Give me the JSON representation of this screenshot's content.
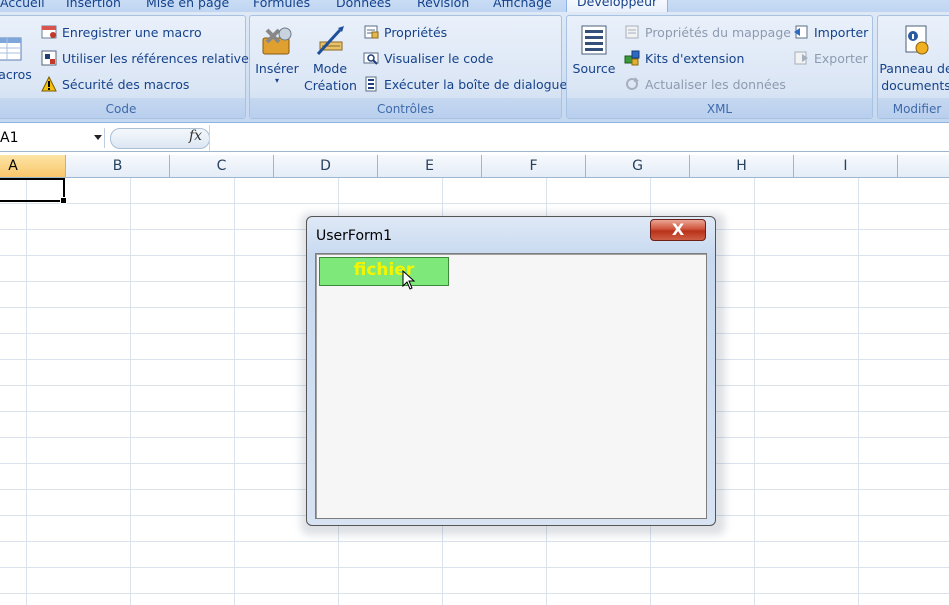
{
  "ribbon": {
    "tabs": [
      "Accueil",
      "Insertion",
      "Mise en page",
      "Formules",
      "Données",
      "Révision",
      "Affichage",
      "Développeur"
    ],
    "active_tab": "Développeur",
    "code": {
      "label": "Code",
      "macros_label": "acros",
      "record_macro": "Enregistrer une macro",
      "relative_refs": "Utiliser les références relatives",
      "macro_security": "Sécurité des macros"
    },
    "controls": {
      "label": "Contrôles",
      "insert": "Insérer",
      "design_mode_line1": "Mode",
      "design_mode_line2": "Création",
      "properties": "Propriétés",
      "view_code": "Visualiser le code",
      "run_dialog": "Exécuter la boîte de dialogue"
    },
    "xml": {
      "label": "XML",
      "source": "Source",
      "map_properties": "Propriétés du mappage",
      "expansion_packs": "Kits d'extension",
      "refresh_data": "Actualiser les données",
      "import": "Importer",
      "export": "Exporter"
    },
    "modify": {
      "label": "Modifier",
      "doc_panel_line1": "Panneau de",
      "doc_panel_line2": "documents"
    }
  },
  "formula_bar": {
    "name_box": "A1",
    "fx": "fx",
    "formula": ""
  },
  "columns": [
    "A",
    "B",
    "C",
    "D",
    "E",
    "F",
    "G",
    "H",
    "I"
  ],
  "selected_column": "A",
  "userform": {
    "title": "UserForm1",
    "close_label": "X",
    "button_label": "fichier",
    "button_bg": "#7fe87a",
    "button_fg": "#f5f500"
  }
}
